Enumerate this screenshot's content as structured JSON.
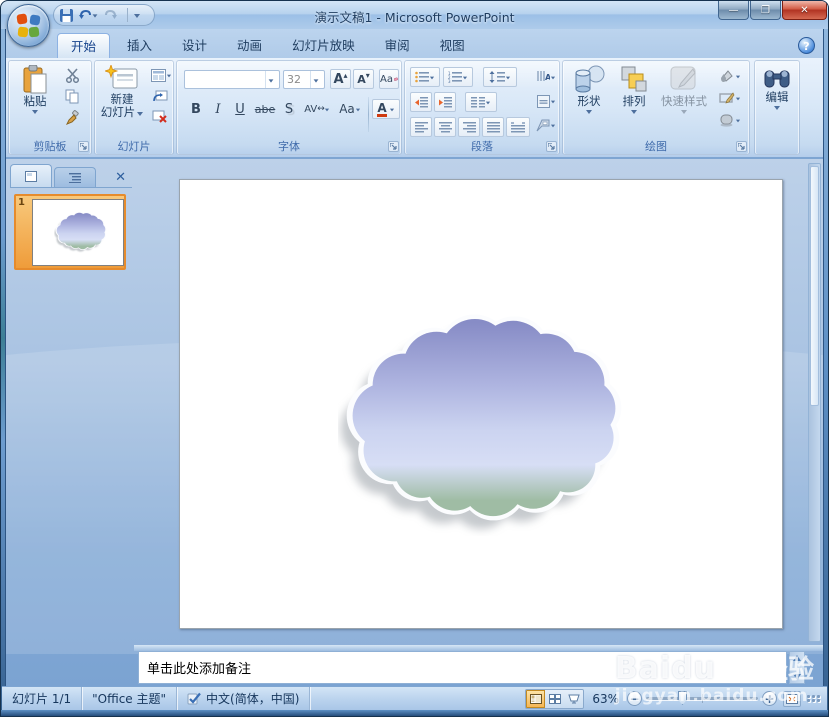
{
  "window": {
    "title": "演示文稿1 - Microsoft PowerPoint"
  },
  "tabs": [
    {
      "label": "开始"
    },
    {
      "label": "插入"
    },
    {
      "label": "设计"
    },
    {
      "label": "动画"
    },
    {
      "label": "幻灯片放映"
    },
    {
      "label": "审阅"
    },
    {
      "label": "视图"
    }
  ],
  "ribbon": {
    "clipboard": {
      "label": "剪贴板",
      "paste": "粘贴"
    },
    "slides": {
      "label": "幻灯片",
      "new_slide_line1": "新建",
      "new_slide_line2": "幻灯片"
    },
    "font": {
      "label": "字体",
      "size": "32",
      "bold": "B",
      "italic": "I",
      "underline": "U",
      "strikethrough": "abe",
      "shadow": "S",
      "char_spacing": "AV",
      "change_case": "Aa",
      "font_color": "A",
      "grow": "A",
      "shrink": "A",
      "clear": "Aa"
    },
    "paragraph": {
      "label": "段落"
    },
    "drawing": {
      "label": "绘图",
      "shapes": "形状",
      "arrange": "排列",
      "quick_styles": "快速样式"
    },
    "editing": {
      "label": "编辑"
    }
  },
  "slides_panel": {
    "slide_number": "1"
  },
  "notes": {
    "placeholder": "单击此处添加备注"
  },
  "status_bar": {
    "slide_indicator": "幻灯片 1/1",
    "theme": "\"Office 主题\"",
    "language": "中文(简体，中国)",
    "zoom_level": "63%"
  },
  "watermark": {
    "brand": "Baidu",
    "suffix": "经验",
    "url": "jingyan.baidu.com"
  },
  "colors": {
    "selection_orange": "#e68b2c",
    "titlebar_blue": "#9cc0e7",
    "cloud_top": "#878cc6",
    "cloud_mid": "#ccd4f1",
    "cloud_bottom": "#9fbca4"
  }
}
